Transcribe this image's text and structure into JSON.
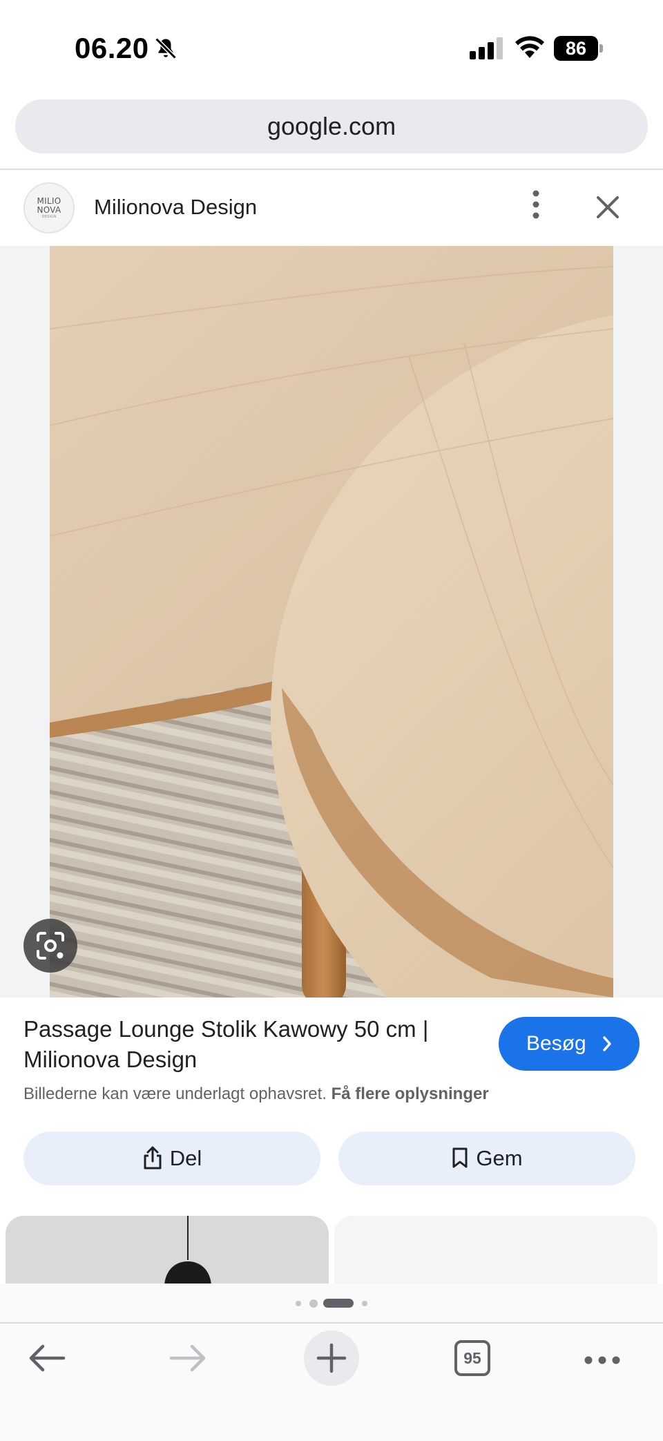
{
  "status_bar": {
    "time": "06.20",
    "battery": "86"
  },
  "browser": {
    "url": "google.com",
    "tab_count": "95"
  },
  "source": {
    "logo_line1": "MILIO",
    "logo_line2": "NOVA",
    "logo_line3": "DESIGN",
    "name": "Milionova Design"
  },
  "result": {
    "title": "Passage Lounge Stolik Kawowy 50 cm | Milionova Design",
    "visit_label": "Besøg",
    "rights_text": "Billederne kan være underlagt ophavsret.",
    "rights_link": "Få flere oplysninger",
    "share_label": "Del",
    "save_label": "Gem"
  },
  "pagination": {
    "total": 4,
    "active_index": 2
  },
  "icons": [
    "bell-muted-icon",
    "signal-icon",
    "wifi-icon",
    "more-vertical-icon",
    "close-icon",
    "lens-icon",
    "chevron-right-icon",
    "share-icon",
    "bookmark-icon",
    "back-arrow-icon",
    "forward-arrow-icon",
    "plus-icon",
    "more-horizontal-icon"
  ],
  "colors": {
    "accent": "#1a73e8",
    "chip_bg": "#e8effb",
    "url_bar_bg": "#e8eaed"
  }
}
